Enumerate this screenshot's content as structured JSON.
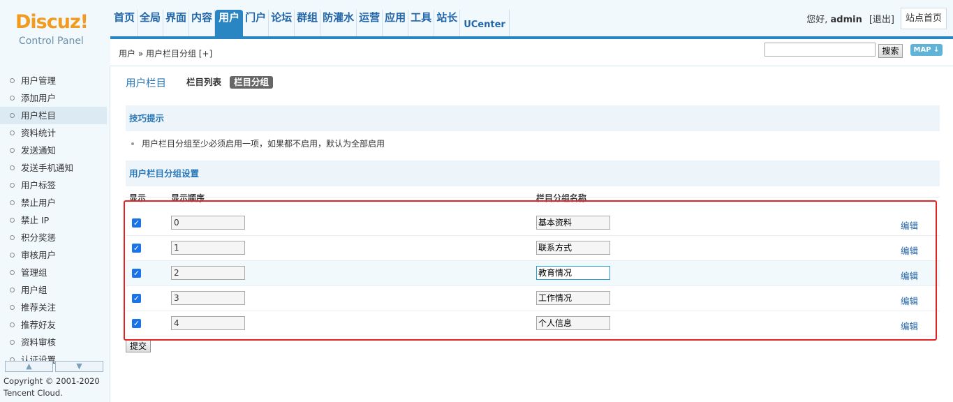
{
  "header": {
    "logo_word": "Discuz!",
    "logo_sub": "Control Panel",
    "nav": [
      "首页",
      "全局",
      "界面",
      "内容",
      "用户",
      "门户",
      "论坛",
      "群组",
      "防灌水",
      "运营",
      "应用",
      "工具",
      "站长",
      "UCenter"
    ],
    "nav_active": "用户",
    "greeting_prefix": "您好,",
    "username": "admin",
    "logout": "[退出]",
    "site_home": "站点首页"
  },
  "breadcrumb": "用户 » 用户栏目分组 [+]",
  "search": {
    "value": "",
    "button": "搜索",
    "map": "MAP ↓"
  },
  "sidebar": {
    "items": [
      "用户管理",
      "添加用户",
      "用户栏目",
      "资料统计",
      "发送通知",
      "发送手机通知",
      "用户标签",
      "禁止用户",
      "禁止 IP",
      "积分奖惩",
      "审核用户",
      "管理组",
      "用户组",
      "推荐关注",
      "推荐好友",
      "资料审核",
      "认证设置"
    ],
    "active": "用户栏目",
    "copyright_line1": "Copyright © 2001-2020",
    "copyright_line2": "Tencent Cloud."
  },
  "main": {
    "title": "用户栏目",
    "tabs": [
      "栏目列表",
      "栏目分组"
    ],
    "tab_active": "栏目分组",
    "tips_title": "技巧提示",
    "tip": "用户栏目分组至少必须启用一项，如果都不启用，默认为全部启用",
    "settings_title": "用户栏目分组设置",
    "columns": {
      "show": "显示",
      "order": "显示顺序",
      "name": "栏目分组名称"
    },
    "rows": [
      {
        "checked": true,
        "order": "0",
        "name": "基本资料",
        "edit": "编辑"
      },
      {
        "checked": true,
        "order": "1",
        "name": "联系方式",
        "edit": "编辑"
      },
      {
        "checked": true,
        "order": "2",
        "name": "教育情况",
        "edit": "编辑"
      },
      {
        "checked": true,
        "order": "3",
        "name": "工作情况",
        "edit": "编辑"
      },
      {
        "checked": true,
        "order": "4",
        "name": "个人信息",
        "edit": "编辑"
      }
    ],
    "submit": "提交"
  },
  "colors": {
    "accent": "#2a86c3",
    "highlight": "#e52222"
  }
}
